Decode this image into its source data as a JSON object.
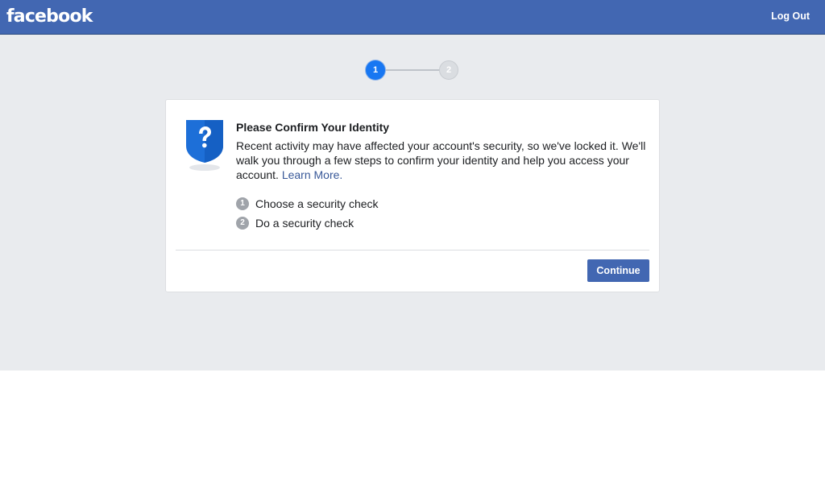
{
  "header": {
    "logo": "facebook",
    "logout_label": "Log Out"
  },
  "stepper": {
    "current_step": "1",
    "next_step": "2"
  },
  "card": {
    "title": "Please Confirm Your Identity",
    "description": "Recent activity may have affected your account's security, so we've locked it. We'll walk you through a few steps to confirm your identity and help you access your account.",
    "learn_more": "Learn More.",
    "steps": [
      {
        "num": "1",
        "label": "Choose a security check"
      },
      {
        "num": "2",
        "label": "Do a security check"
      }
    ],
    "continue_label": "Continue"
  },
  "colors": {
    "brand_blue": "#4267b2",
    "active_step": "#1877f2",
    "page_background": "#e9ebee"
  },
  "icons": [
    "shield-question-icon"
  ]
}
